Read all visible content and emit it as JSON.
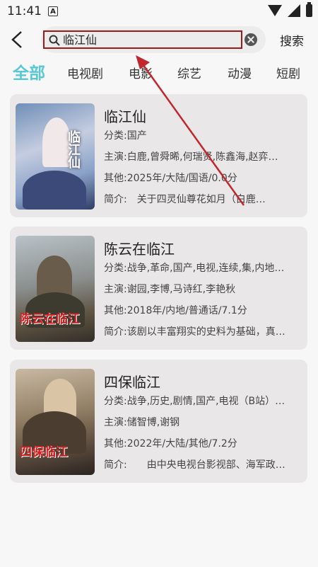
{
  "status": {
    "time": "11:41",
    "notif_icon": "A"
  },
  "header": {
    "search_value": "临江仙",
    "search_button": "搜索"
  },
  "tabs": [
    {
      "label": "全部",
      "active": true
    },
    {
      "label": "电视剧"
    },
    {
      "label": "电影"
    },
    {
      "label": "综艺"
    },
    {
      "label": "动漫"
    },
    {
      "label": "短剧"
    }
  ],
  "results": [
    {
      "title": "临江仙",
      "poster_text": "临江仙",
      "genre_label": "分类:",
      "genre": "国产",
      "cast_label": "主演:",
      "cast": "白鹿,曾舜晞,何瑞贤,陈鑫海,赵弈…",
      "other_label": "其他:",
      "other": "2025年/大陆/国语/0.0分",
      "intro_label": "简介:",
      "intro": "　关于四灵仙尊花如月（白鹿…"
    },
    {
      "title": "陈云在临江",
      "poster_text": "陈云在临江",
      "genre_label": "分类:",
      "genre": "战争,革命,国产,电视,连续,集,内地…",
      "cast_label": "主演:",
      "cast": "谢园,李博,马诗红,李艳秋",
      "other_label": "其他:",
      "other": "2018年/内地/普通话/7.1分",
      "intro_label": "简介:",
      "intro": "该剧以丰富翔实的史料为基础，真…"
    },
    {
      "title": "四保临江",
      "poster_text": "四保临江",
      "genre_label": "分类:",
      "genre": "战争,历史,剧情,国产,电视（B站）…",
      "cast_label": "主演:",
      "cast": "储智博,谢钢",
      "other_label": "其他:",
      "other": "2022年/大陆/其他/7.2分",
      "intro_label": "简介:",
      "intro": "　　由中央电视台影视部、海军政…"
    }
  ],
  "colors": {
    "accent": "#58c8d6",
    "highlight": "#9b1b1b",
    "arrow": "#c0272d"
  }
}
